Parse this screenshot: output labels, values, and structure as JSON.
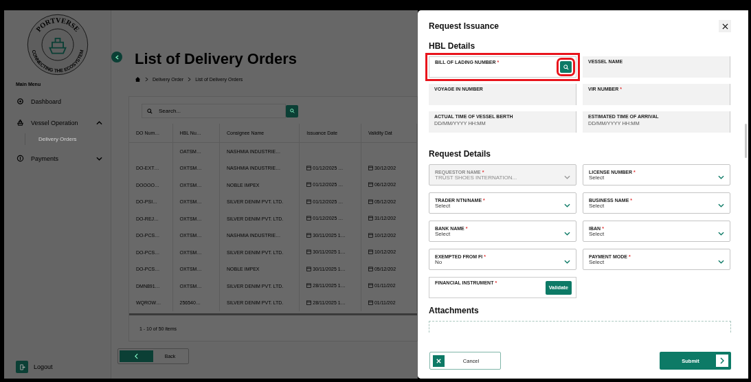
{
  "sidebar": {
    "logo": {
      "name": "PORTVERSE",
      "tagline": "CONNECTING THE ECOSYSTEM"
    },
    "menu_heading": "Main Menu",
    "items": [
      {
        "label": "Dashboard",
        "kind": "link"
      },
      {
        "label": "Vessel Operation",
        "kind": "group",
        "expanded": true,
        "children": [
          {
            "label": "Delivery Orders",
            "selected": true
          }
        ]
      },
      {
        "label": "Payments",
        "kind": "group",
        "expanded": false
      }
    ],
    "logout": "Logout"
  },
  "page": {
    "title": "List of Delivery Orders",
    "breadcrumb": [
      "Delivery Order",
      "List of Delivery Orders"
    ],
    "search": {
      "placeholder": "Search..."
    },
    "table": {
      "columns": [
        "DO Num…",
        "HBL Nu…",
        "Consignee Name",
        "Issuance Date",
        "Validity Dat"
      ],
      "rows": [
        [
          "",
          "OATSM…",
          "NASHMIA INDUSTRIE…",
          "",
          ""
        ],
        [
          "DO-EXT…",
          "OXTSM…",
          "NASHMIA INDUSTRIE…",
          "01/12/2025 …",
          "30/12/202"
        ],
        [
          "DOOOO…",
          "OXTSM…",
          "NOBLE IMPEX",
          "01/12/2025 …",
          "06/12/202"
        ],
        [
          "DO-PSI…",
          "OXTSM…",
          "SILVER DENIM PVT. LTD.",
          "01/12/2025 …",
          "05/12/202"
        ],
        [
          "DO-REJ…",
          "OXTSM…",
          "SILVER DENIM PVT. LTD.",
          "01/12/2025 …",
          "31/12/202"
        ],
        [
          "DO-PCS…",
          "OXTSM…",
          "NASHMIA INDUSTRIE…",
          "30/11/2025 1…",
          "10/12/202"
        ],
        [
          "DO-PCS…",
          "OXTSM…",
          "SILVER DENIM PVT. LTD.",
          "30/11/2025 1…",
          "10/12/202"
        ],
        [
          "DO-PCS…",
          "OXTSM…",
          "NOBLE IMPEX",
          "30/11/2025 1…",
          "05/12/202"
        ],
        [
          "DMN891…",
          "OXTSM…",
          "SILVER DENIM PVT. LTD.",
          "28/11/2025 1…",
          "01/11/202"
        ],
        [
          "WQROW…",
          "256540…",
          "SILVER DENIM PVT. LTD.",
          "28/11/2025 1…",
          "01/11/202"
        ]
      ]
    },
    "pagination": "1 - 10 of 50 items",
    "back_button": "Back"
  },
  "drawer": {
    "title": "Request Issuance",
    "hbl_heading": "HBL Details",
    "hbl_fields": [
      {
        "label": "BILL OF LADING NUMBER",
        "required_mark": "*",
        "kind": "search",
        "highlighted": true
      },
      {
        "label": "VESSEL NAME",
        "kind": "readonly"
      },
      {
        "label": "VOYAGE IN NUMBER",
        "kind": "readonly"
      },
      {
        "label": "VIR NUMBER",
        "required_mark": "*",
        "kind": "readonly"
      },
      {
        "label": "ACTUAL TIME OF VESSEL BERTH",
        "kind": "readonly",
        "placeholder": "DD/MM/YYYY HH:MM"
      },
      {
        "label": "ESTIMATED TIME OF ARRIVAL",
        "kind": "readonly",
        "placeholder": "DD/MM/YYYY HH:MM"
      }
    ],
    "request_heading": "Request Details",
    "request_fields": [
      {
        "label": "REQUESTOR NAME",
        "required_mark": "*",
        "kind": "select",
        "value": "TRUST SHOES INTERNATION...",
        "disabled": true
      },
      {
        "label": "LICENSE NUMBER",
        "required_mark": "*",
        "kind": "select",
        "value": "Select",
        "disabled": false
      },
      {
        "label": "TRADER NTN/NAME",
        "required_mark": "*",
        "kind": "select",
        "value": "Select",
        "disabled": false
      },
      {
        "label": "BUSINESS NAME",
        "required_mark": "*",
        "kind": "select",
        "value": "Select",
        "disabled": false
      },
      {
        "label": "BANK NAME",
        "required_mark": "*",
        "kind": "select",
        "value": "Select",
        "disabled": false
      },
      {
        "label": "IBAN",
        "required_mark": "*",
        "kind": "select",
        "value": "Select",
        "disabled": false
      },
      {
        "label": "EXEMPTED FROM FI",
        "required_mark": "*",
        "kind": "select",
        "value": "No",
        "disabled": false
      },
      {
        "label": "PAYMENT MODE",
        "required_mark": "*",
        "kind": "select",
        "value": "Select",
        "disabled": false
      },
      {
        "label": "FINANCIAL INSTRUMENT",
        "required_mark": "*",
        "kind": "validate",
        "button": "Validate"
      }
    ],
    "attachments_heading": "Attachments",
    "cancel_button": "Cancel",
    "submit_button": "Submit"
  }
}
